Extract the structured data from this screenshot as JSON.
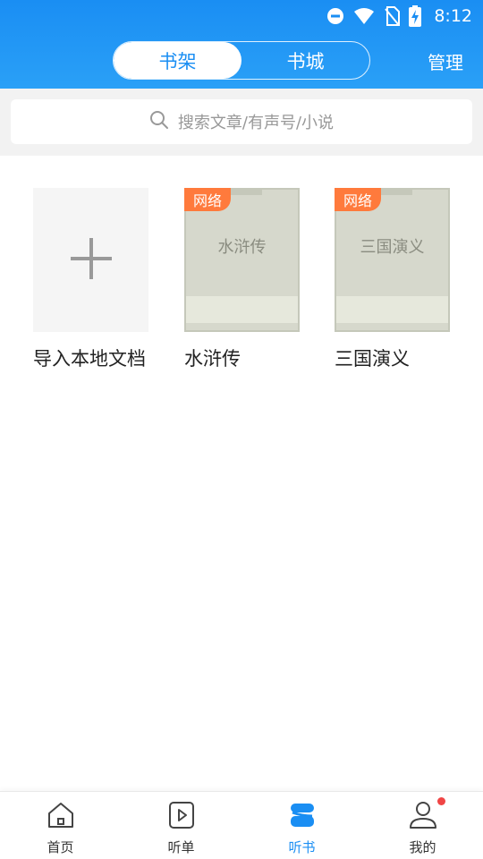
{
  "status_bar": {
    "time": "8:12"
  },
  "header": {
    "tabs": [
      {
        "label": "书架",
        "active": true
      },
      {
        "label": "书城",
        "active": false
      }
    ],
    "manage_label": "管理"
  },
  "search": {
    "placeholder": "搜索文章/有声号/小说"
  },
  "shelf": {
    "import_label": "导入本地文档",
    "books": [
      {
        "title": "水浒传",
        "cover_title": "水浒传",
        "tag": "网络"
      },
      {
        "title": "三国演义",
        "cover_title": "三国演义",
        "tag": "网络"
      }
    ]
  },
  "bottom_nav": [
    {
      "label": "首页",
      "icon": "home-icon",
      "active": false
    },
    {
      "label": "听单",
      "icon": "play-icon",
      "active": false
    },
    {
      "label": "听书",
      "icon": "book-stack-icon",
      "active": true
    },
    {
      "label": "我的",
      "icon": "user-icon",
      "active": false,
      "badge": true
    }
  ],
  "colors": {
    "accent": "#1a8ef3",
    "tag": "#ff7a3c",
    "badge": "#f04545"
  }
}
